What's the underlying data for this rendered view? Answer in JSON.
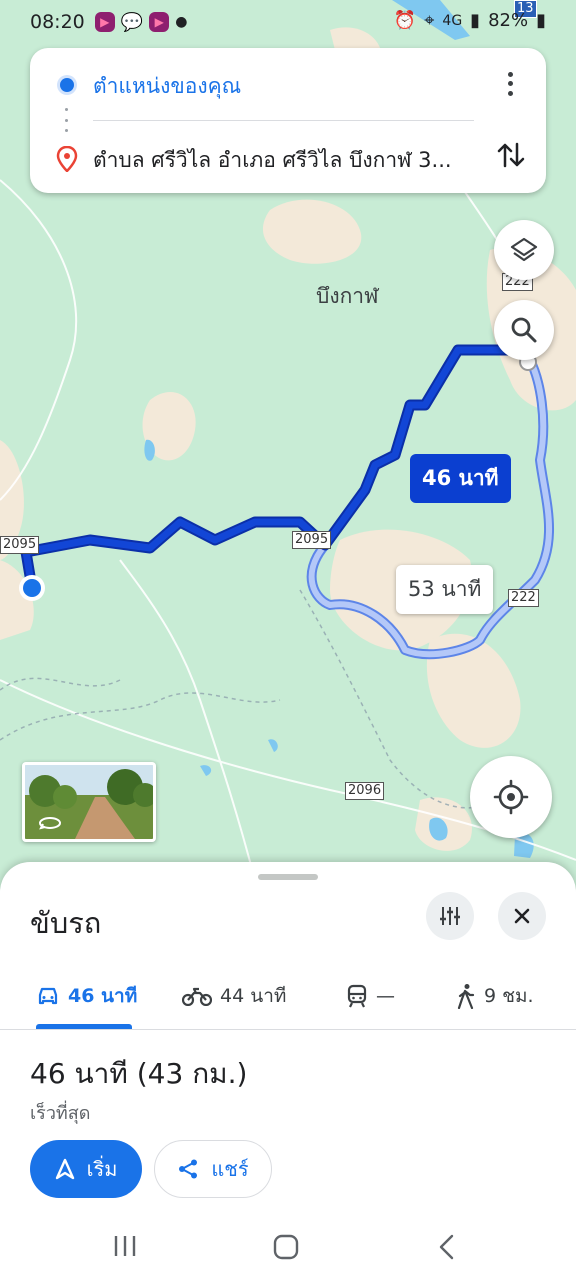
{
  "status_bar": {
    "time": "08:20",
    "network": "4G",
    "battery": "82%"
  },
  "route_card": {
    "origin": "ตำแหน่งของคุณ",
    "destination": "ตำบล ศรีวิไล อำเภอ ศรีวิไล บึงกาฬ 3..."
  },
  "map": {
    "town_label": "บึงกาฬ",
    "road_labels": [
      "2095",
      "2095",
      "222",
      "222",
      "2096",
      "13"
    ],
    "route_primary_label": "46 นาที",
    "route_alt_label": "53 นาที",
    "colors": {
      "route_primary": "#1246d6",
      "route_alt": "#9ab2f3",
      "land": "#c8ecd5",
      "urban": "#f3e9d9",
      "water": "#7fc8f0"
    }
  },
  "sheet": {
    "title": "ขับรถ",
    "modes": [
      {
        "icon": "car-icon",
        "label": "46 นาที",
        "active": true
      },
      {
        "icon": "motorcycle-icon",
        "label": "44 นาที",
        "active": false
      },
      {
        "icon": "transit-icon",
        "label": "—",
        "active": false
      },
      {
        "icon": "walk-icon",
        "label": "9 ชม.",
        "active": false
      }
    ],
    "summary": "46 นาที (43 กม.)",
    "summary_sub": "เร็วที่สุด",
    "start_label": "เริ่ม",
    "share_label": "แชร์"
  }
}
